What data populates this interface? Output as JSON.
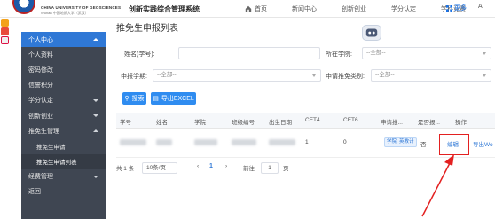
{
  "header": {
    "logo_en": "CHINA UNIVERSITY OF GEOSCIENCES",
    "logo_cn": "Wuhan  中国地质大学（武汉）",
    "system_title": "创新实践综合管理系统",
    "nav": [
      "首页",
      "新闻中心",
      "创新创业",
      "学分认定",
      "学科竞赛"
    ],
    "more": "更多",
    "user": "A"
  },
  "sidebar": {
    "items": [
      {
        "label": "个人中心",
        "type": "active"
      },
      {
        "label": "个人资料",
        "type": "item"
      },
      {
        "label": "密码修改",
        "type": "item"
      },
      {
        "label": "信誉积分",
        "type": "item"
      },
      {
        "label": "学分认定",
        "type": "group"
      },
      {
        "label": "创新创业",
        "type": "group"
      },
      {
        "label": "推免生管理",
        "type": "group-open"
      },
      {
        "label": "推免生申请",
        "type": "sub"
      },
      {
        "label": "推免生申请列表",
        "type": "sub-current"
      },
      {
        "label": "经费管理",
        "type": "group"
      },
      {
        "label": "返回",
        "type": "item"
      }
    ]
  },
  "page": {
    "title": "推免生申报列表"
  },
  "form": {
    "name_label": "姓名(学号):",
    "name_value": "",
    "college_label": "所在学院:",
    "college_value": "--全部--",
    "term_label": "申报学期:",
    "term_value": "--全部--",
    "category_label": "申请推免类别:",
    "category_value": "--全部--"
  },
  "actions": {
    "search": "搜索",
    "export": "导出EXCEL"
  },
  "table": {
    "columns": [
      "学号",
      "姓名",
      "学院",
      "班级编号",
      "出生日期",
      "CET4",
      "CET6",
      "申请推...",
      "是否报...",
      "操作"
    ],
    "rows": [
      {
        "cet4": "1",
        "cet6": "0",
        "category": "学院, 英教计",
        "reported": "否",
        "edit": "编辑",
        "extra": "导出Wo"
      }
    ]
  },
  "pagination": {
    "total": "共 1 条",
    "page_size": "10条/页",
    "current": "1",
    "goto_label": "前往",
    "goto_value": "1",
    "page_unit": "页"
  },
  "colors": {
    "sidebar_bg": "#3f4652",
    "accent": "#2f78d6",
    "button": "#2f8cf0",
    "highlight": "#e32020"
  }
}
